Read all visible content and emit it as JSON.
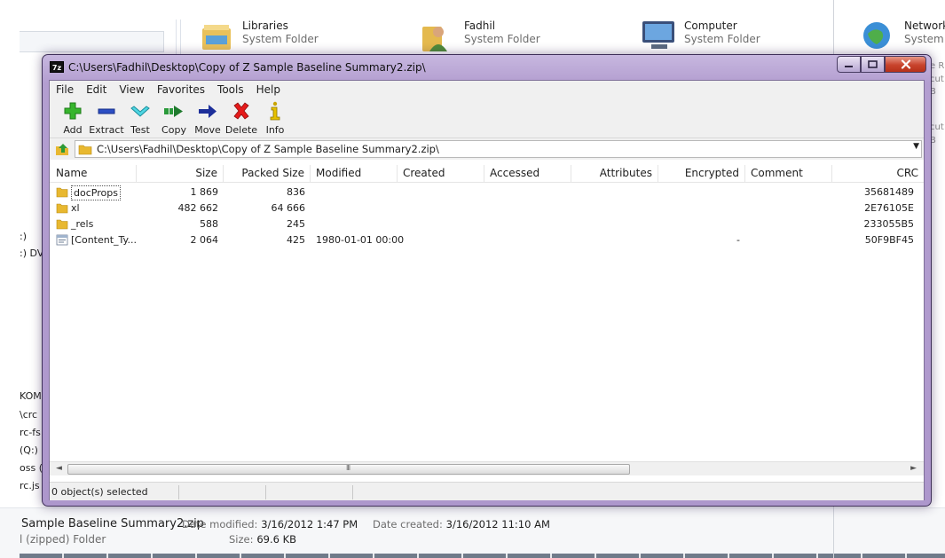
{
  "explorer": {
    "tiles": [
      {
        "name": "Libraries",
        "type": "System Folder"
      },
      {
        "name": "Fadhil",
        "type": "System Folder"
      },
      {
        "name": "Computer",
        "type": "System Folder"
      },
      {
        "name": "Network",
        "type": "System F"
      }
    ],
    "nav_fragments": [
      ":)",
      ":) DV",
      "KOM",
      "\\crc",
      "rc-fs",
      "(Q:)",
      "oss (",
      "rc.js"
    ],
    "right_fragments": [
      "e R",
      "cut",
      "B",
      "cut",
      "B"
    ],
    "details": {
      "name": "Sample Baseline Summary2.zip",
      "type": "l (zipped) Folder",
      "date_modified_label": "Date modified:",
      "date_modified": "3/16/2012 1:47 PM",
      "date_created_label": "Date created:",
      "date_created": "3/16/2012 11:10 AM",
      "size_label": "Size:",
      "size": "69.6 KB"
    }
  },
  "window": {
    "title": "C:\\Users\\Fadhil\\Desktop\\Copy of Z  Sample Baseline Summary2.zip\\",
    "app_icon_text": "7z",
    "menu": [
      "File",
      "Edit",
      "View",
      "Favorites",
      "Tools",
      "Help"
    ],
    "toolbar": [
      {
        "label": "Add",
        "icon": "plus-icon"
      },
      {
        "label": "Extract",
        "icon": "minus-icon"
      },
      {
        "label": "Test",
        "icon": "checkmark-icon"
      },
      {
        "label": "Copy",
        "icon": "double-arrow-icon"
      },
      {
        "label": "Move",
        "icon": "arrow-right-icon"
      },
      {
        "label": "Delete",
        "icon": "x-icon"
      },
      {
        "label": "Info",
        "icon": "info-icon"
      }
    ],
    "path": "C:\\Users\\Fadhil\\Desktop\\Copy of Z  Sample Baseline Summary2.zip\\",
    "columns": [
      "Name",
      "Size",
      "Packed Size",
      "Modified",
      "Created",
      "Accessed",
      "Attributes",
      "Encrypted",
      "Comment",
      "CRC"
    ],
    "rows": [
      {
        "name": "docProps",
        "size": "1 869",
        "packed": "836",
        "modified": "",
        "encrypted": "",
        "crc": "35681489",
        "kind": "folder",
        "selected": true
      },
      {
        "name": "xl",
        "size": "482 662",
        "packed": "64 666",
        "modified": "",
        "encrypted": "",
        "crc": "2E76105E",
        "kind": "folder",
        "selected": false
      },
      {
        "name": "_rels",
        "size": "588",
        "packed": "245",
        "modified": "",
        "encrypted": "",
        "crc": "233055B5",
        "kind": "folder",
        "selected": false
      },
      {
        "name": "[Content_Ty...",
        "size": "2 064",
        "packed": "425",
        "modified": "1980-01-01 00:00",
        "encrypted": "-",
        "crc": "50F9BF45",
        "kind": "file",
        "selected": false
      }
    ],
    "status": "0 object(s) selected",
    "scroll_grip": "III",
    "colors": {
      "title_frame": "#b39ed0",
      "close_button": "#c8432c",
      "folder": "#e8b830"
    }
  }
}
